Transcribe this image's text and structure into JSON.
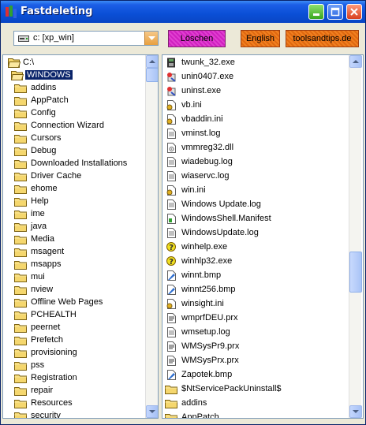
{
  "window": {
    "title": "Fastdeleting"
  },
  "toolbar": {
    "drive": {
      "value": "c: [xp_win]"
    },
    "delete_label": "Löschen",
    "english_label": "English",
    "tips_label": "toolsandtips.de"
  },
  "tree": {
    "root": "C:\\",
    "selected": "WINDOWS",
    "folders": [
      "addins",
      "AppPatch",
      "Config",
      "Connection Wizard",
      "Cursors",
      "Debug",
      "Downloaded Installations",
      "Driver Cache",
      "ehome",
      "Help",
      "ime",
      "java",
      "Media",
      "msagent",
      "msapps",
      "mui",
      "nview",
      "Offline Web Pages",
      "PCHEALTH",
      "peernet",
      "Prefetch",
      "provisioning",
      "pss",
      "Registration",
      "repair",
      "Resources",
      "security"
    ]
  },
  "files": {
    "items": [
      {
        "name": "twunk_32.exe",
        "icon": "scanner-exe-icon"
      },
      {
        "name": "unin0407.exe",
        "icon": "uninstall-exe-icon"
      },
      {
        "name": "uninst.exe",
        "icon": "uninstall-exe-icon"
      },
      {
        "name": "vb.ini",
        "icon": "ini-file-icon"
      },
      {
        "name": "vbaddin.ini",
        "icon": "ini-file-icon"
      },
      {
        "name": "vminst.log",
        "icon": "text-file-icon"
      },
      {
        "name": "vmmreg32.dll",
        "icon": "dll-file-icon"
      },
      {
        "name": "wiadebug.log",
        "icon": "text-file-icon"
      },
      {
        "name": "wiaservc.log",
        "icon": "text-file-icon"
      },
      {
        "name": "win.ini",
        "icon": "ini-file-icon"
      },
      {
        "name": "Windows Update.log",
        "icon": "text-file-icon"
      },
      {
        "name": "WindowsShell.Manifest",
        "icon": "manifest-file-icon"
      },
      {
        "name": "WindowsUpdate.log",
        "icon": "text-file-icon"
      },
      {
        "name": "winhelp.exe",
        "icon": "help-exe-icon"
      },
      {
        "name": "winhlp32.exe",
        "icon": "help-exe-icon"
      },
      {
        "name": "winnt.bmp",
        "icon": "bitmap-file-icon"
      },
      {
        "name": "winnt256.bmp",
        "icon": "bitmap-file-icon"
      },
      {
        "name": "winsight.ini",
        "icon": "ini-file-icon"
      },
      {
        "name": "wmprfDEU.prx",
        "icon": "prx-file-icon"
      },
      {
        "name": "wmsetup.log",
        "icon": "text-file-icon"
      },
      {
        "name": "WMSysPr9.prx",
        "icon": "prx-file-icon"
      },
      {
        "name": "WMSysPrx.prx",
        "icon": "prx-file-icon"
      },
      {
        "name": "Zapotek.bmp",
        "icon": "bitmap-file-icon"
      },
      {
        "name": "$NtServicePackUninstall$",
        "icon": "folder-icon"
      },
      {
        "name": "addins",
        "icon": "folder-icon"
      },
      {
        "name": "AppPatch",
        "icon": "folder-icon"
      }
    ]
  },
  "scrollbars": {
    "tree_position": 0,
    "files_position": 0.62
  },
  "colors": {
    "titlebar": "#0a4fd6",
    "selection": "#0a246a",
    "folder": "#f5d76e",
    "delete_button": "#e040d0",
    "language_button": "#f08020"
  }
}
